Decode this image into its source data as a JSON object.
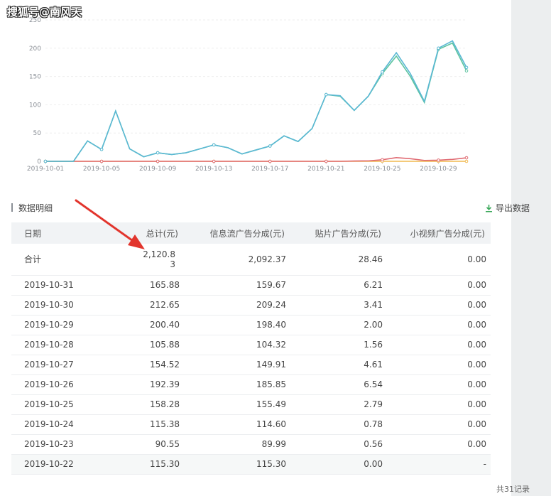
{
  "watermark": "搜狐号@南风天",
  "chart_data": {
    "type": "line",
    "x": [
      "2019-10-01",
      "2019-10-02",
      "2019-10-03",
      "2019-10-04",
      "2019-10-05",
      "2019-10-06",
      "2019-10-07",
      "2019-10-08",
      "2019-10-09",
      "2019-10-10",
      "2019-10-11",
      "2019-10-12",
      "2019-10-13",
      "2019-10-14",
      "2019-10-15",
      "2019-10-16",
      "2019-10-17",
      "2019-10-18",
      "2019-10-19",
      "2019-10-20",
      "2019-10-21",
      "2019-10-22",
      "2019-10-23",
      "2019-10-24",
      "2019-10-25",
      "2019-10-26",
      "2019-10-27",
      "2019-10-28",
      "2019-10-29",
      "2019-10-30",
      "2019-10-31"
    ],
    "x_tick_labels": [
      "2019-10-01",
      "2019-10-05",
      "2019-10-09",
      "2019-10-13",
      "2019-10-17",
      "2019-10-21",
      "2019-10-25",
      "2019-10-29"
    ],
    "y_ticks": [
      0,
      50,
      100,
      150,
      200,
      250
    ],
    "ylim": [
      0,
      250
    ],
    "grid": true,
    "series": [
      {
        "color": "#5bb8d4",
        "values": [
          0,
          0,
          0,
          36,
          21,
          89,
          22,
          8,
          15,
          12,
          15,
          22,
          29,
          24,
          13,
          20,
          27,
          45,
          35,
          58,
          118,
          116,
          90,
          115,
          158,
          192,
          155,
          106,
          200,
          213,
          166
        ]
      },
      {
        "color": "#5dc4a0",
        "values": [
          0,
          0,
          0,
          36,
          21,
          89,
          22,
          8,
          15,
          12,
          15,
          22,
          29,
          24,
          13,
          20,
          27,
          45,
          35,
          58,
          118,
          115,
          90,
          115,
          155,
          186,
          150,
          104,
          198,
          209,
          160
        ]
      },
      {
        "color": "#e06b73",
        "values": [
          0,
          0,
          0,
          0,
          0,
          0,
          0,
          0,
          0,
          0,
          0,
          0,
          0,
          0,
          0,
          0,
          0,
          0,
          0,
          0,
          0,
          0,
          0.56,
          0.78,
          2.79,
          6.54,
          4.61,
          1.56,
          2,
          3.41,
          6.21
        ]
      },
      {
        "color": "#f0b84e",
        "values": [
          0,
          0,
          0,
          0,
          0,
          0,
          0,
          0,
          0,
          0,
          0,
          0,
          0,
          0,
          0,
          0,
          0,
          0,
          0,
          0,
          0,
          0,
          0,
          0,
          0,
          0,
          0,
          0,
          0,
          0,
          0
        ]
      }
    ]
  },
  "section": {
    "title": "数据明细",
    "export_label": "导出数据",
    "export_icon": "download-icon"
  },
  "table": {
    "headers": {
      "date": "日期",
      "total": "总计(元)",
      "feed": "信息流广告分成(元)",
      "sticker": "贴片广告分成(元)",
      "short_video": "小视频广告分成(元)"
    },
    "total_row": {
      "date": "合计",
      "total": "2,120.8\n3",
      "feed": "2,092.37",
      "sticker": "28.46",
      "short_video": "0.00"
    },
    "rows": [
      {
        "date": "2019-10-31",
        "total": "165.88",
        "feed": "159.67",
        "sticker": "6.21",
        "short_video": "0.00"
      },
      {
        "date": "2019-10-30",
        "total": "212.65",
        "feed": "209.24",
        "sticker": "3.41",
        "short_video": "0.00"
      },
      {
        "date": "2019-10-29",
        "total": "200.40",
        "feed": "198.40",
        "sticker": "2.00",
        "short_video": "0.00"
      },
      {
        "date": "2019-10-28",
        "total": "105.88",
        "feed": "104.32",
        "sticker": "1.56",
        "short_video": "0.00"
      },
      {
        "date": "2019-10-27",
        "total": "154.52",
        "feed": "149.91",
        "sticker": "4.61",
        "short_video": "0.00"
      },
      {
        "date": "2019-10-26",
        "total": "192.39",
        "feed": "185.85",
        "sticker": "6.54",
        "short_video": "0.00"
      },
      {
        "date": "2019-10-25",
        "total": "158.28",
        "feed": "155.49",
        "sticker": "2.79",
        "short_video": "0.00"
      },
      {
        "date": "2019-10-24",
        "total": "115.38",
        "feed": "114.60",
        "sticker": "0.78",
        "short_video": "0.00"
      },
      {
        "date": "2019-10-23",
        "total": "90.55",
        "feed": "89.99",
        "sticker": "0.56",
        "short_video": "0.00"
      },
      {
        "date": "2019-10-22",
        "total": "115.30",
        "feed": "115.30",
        "sticker": "0.00",
        "short_video": "-"
      }
    ]
  },
  "footer": {
    "record_count": "共31记录"
  },
  "colors": {
    "arrow": "#e2352d",
    "header_bg": "#f1f3f5",
    "export_icon": "#3aa85a"
  }
}
